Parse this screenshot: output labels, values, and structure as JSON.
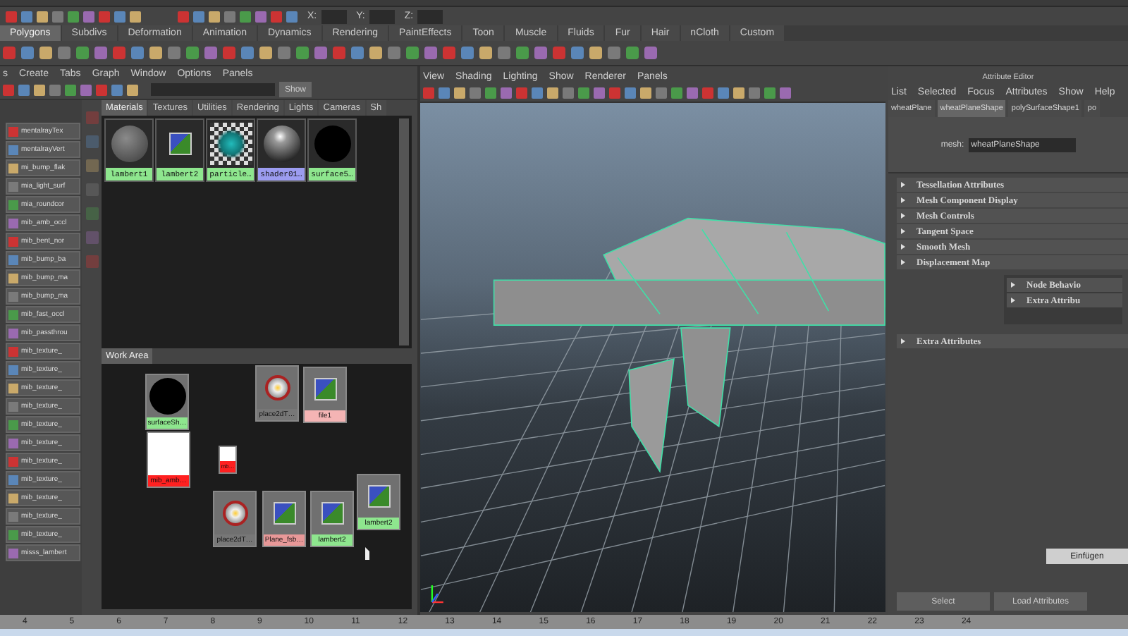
{
  "status_line": {
    "coord_labels": [
      "X:",
      "Y:",
      "Z:"
    ]
  },
  "shelf_tabs": [
    {
      "label": "Polygons",
      "selected": true
    },
    {
      "label": "Subdivs",
      "selected": false
    },
    {
      "label": "Deformation",
      "selected": false
    },
    {
      "label": "Animation",
      "selected": false
    },
    {
      "label": "Dynamics",
      "selected": false
    },
    {
      "label": "Rendering",
      "selected": false
    },
    {
      "label": "PaintEffects",
      "selected": false
    },
    {
      "label": "Toon",
      "selected": false
    },
    {
      "label": "Muscle",
      "selected": false
    },
    {
      "label": "Fluids",
      "selected": false
    },
    {
      "label": "Fur",
      "selected": false
    },
    {
      "label": "Hair",
      "selected": false
    },
    {
      "label": "nCloth",
      "selected": false
    },
    {
      "label": "Custom",
      "selected": false
    }
  ],
  "hypershade": {
    "menu": [
      "s",
      "Create",
      "Tabs",
      "Graph",
      "Window",
      "Options",
      "Panels"
    ],
    "show_button": "Show",
    "node_list": [
      "mentalrayTex",
      "mentalrayVert",
      "mi_bump_flak",
      "mia_light_surf",
      "mia_roundcor",
      "mib_amb_occl",
      "mib_bent_nor",
      "mib_bump_ba",
      "mib_bump_ma",
      "mib_bump_ma",
      "mib_fast_occl",
      "mib_passthrou",
      "mib_texture_",
      "mib_texture_",
      "mib_texture_",
      "mib_texture_",
      "mib_texture_",
      "mib_texture_",
      "mib_texture_",
      "mib_texture_",
      "mib_texture_",
      "mib_texture_",
      "mib_texture_",
      "misss_lambert"
    ],
    "tabs": [
      {
        "label": "Materials",
        "selected": true
      },
      {
        "label": "Textures",
        "selected": false
      },
      {
        "label": "Utilities",
        "selected": false
      },
      {
        "label": "Rendering",
        "selected": false
      },
      {
        "label": "Lights",
        "selected": false
      },
      {
        "label": "Cameras",
        "selected": false
      },
      {
        "label": "Sh",
        "selected": false
      }
    ],
    "swatches": [
      {
        "label": "lambert1",
        "kind": "matte",
        "color": "#8ee68e"
      },
      {
        "label": "lambert2",
        "kind": "texture",
        "color": "#8ee68e"
      },
      {
        "label": "particle…",
        "kind": "checker",
        "color": "#8ee68e"
      },
      {
        "label": "shader01…",
        "kind": "shiny",
        "color": "#9c9cf0"
      },
      {
        "label": "surface5…",
        "kind": "black",
        "color": "#8ee68e"
      }
    ],
    "work_area_tab": "Work Area",
    "nodes": [
      {
        "label": "surfaceSh…",
        "kind": "black",
        "color": "#8ee68e"
      },
      {
        "label": "mib_amb…",
        "kind": "blank",
        "color": "#ff2020"
      },
      {
        "label": "place2dT…",
        "kind": "placement",
        "color": "#777777"
      },
      {
        "label": "file1",
        "kind": "texture",
        "color": "#f4b4b4"
      },
      {
        "label": "mb…",
        "kind": "blank",
        "color": "#ff2020"
      },
      {
        "label": "place2dT…",
        "kind": "placement",
        "color": "#777777"
      },
      {
        "label": "Plane_fsb…",
        "kind": "texture",
        "color": "#e89898"
      },
      {
        "label": "lambert2",
        "kind": "texture",
        "color": "#8ee68e"
      },
      {
        "label": "lambert2",
        "kind": "texture",
        "color": "#8ee68e"
      }
    ]
  },
  "viewport": {
    "menu": [
      "View",
      "Shading",
      "Lighting",
      "Show",
      "Renderer",
      "Panels"
    ]
  },
  "attribute_editor": {
    "title": "Attribute Editor",
    "menu": [
      "List",
      "Selected",
      "Focus",
      "Attributes",
      "Show",
      "Help"
    ],
    "tabs": [
      {
        "label": "wheatPlane",
        "selected": false
      },
      {
        "label": "wheatPlaneShape",
        "selected": true
      },
      {
        "label": "polySurfaceShape1",
        "selected": false
      },
      {
        "label": "po",
        "selected": false
      }
    ],
    "mesh_label": "mesh:",
    "mesh_value": "wheatPlaneShape",
    "sections": [
      {
        "label": "Tessellation Attributes",
        "expanded": false
      },
      {
        "label": "Mesh Component Display",
        "expanded": false
      },
      {
        "label": "Mesh Controls",
        "expanded": false
      },
      {
        "label": "Tangent Space",
        "expanded": false
      },
      {
        "label": "Smooth Mesh",
        "expanded": false
      },
      {
        "label": "Displacement Map",
        "expanded": false
      }
    ],
    "overlay_sections": [
      {
        "label": "Node Behavio",
        "expanded": false
      },
      {
        "label": "Extra Attribu",
        "expanded": false
      }
    ],
    "lower_sections": [
      {
        "label": "Extra Attributes",
        "expanded": false
      }
    ],
    "paste_button": "Einfügen",
    "buttons": [
      "Select",
      "Load Attributes"
    ]
  },
  "timeline": {
    "ticks": [
      "4",
      "5",
      "6",
      "7",
      "8",
      "9",
      "10",
      "11",
      "12",
      "13",
      "14",
      "15",
      "16",
      "17",
      "18",
      "19",
      "20",
      "21",
      "22",
      "23",
      "24"
    ]
  }
}
